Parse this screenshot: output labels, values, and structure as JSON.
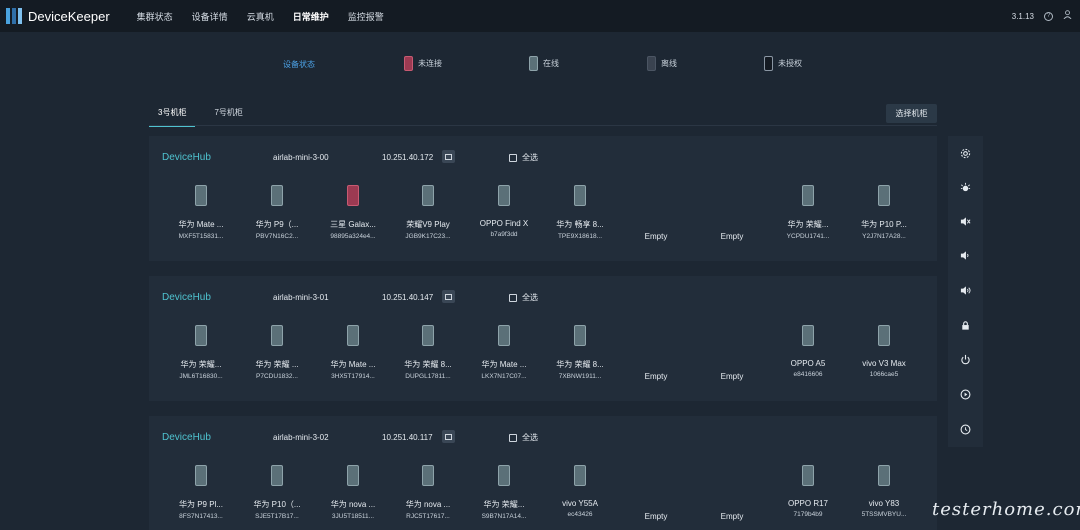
{
  "app": {
    "title": "DeviceKeeper",
    "version": "3.1.13"
  },
  "nav": {
    "items": [
      "集群状态",
      "设备详情",
      "云真机",
      "日常维护",
      "监控报警"
    ],
    "active_index": 3
  },
  "legend": {
    "title": "设备状态",
    "items": [
      {
        "label": "未连接",
        "color": "#9c3a52"
      },
      {
        "label": "在线",
        "color": "#5b7078"
      },
      {
        "label": "离线",
        "color": "#3a4350"
      },
      {
        "label": "未授权",
        "color": "#1a2028"
      }
    ]
  },
  "tabs": {
    "items": [
      "3号机柜",
      "7号机柜"
    ],
    "active_index": 0
  },
  "select_cabinet_label": "选择机柜",
  "select_all_label": "全选",
  "empty_label": "Empty",
  "cabinets": [
    {
      "hub": "DeviceHub",
      "id": "airlab-mini-3-00",
      "ip": "10.251.40.172",
      "slots": [
        {
          "name": "华为 Mate ...",
          "serial": "MXF5T15831...",
          "status": "online"
        },
        {
          "name": "华为 P9（...",
          "serial": "PBV7N16C2...",
          "status": "online"
        },
        {
          "name": "三星 Galax...",
          "serial": "98895a324e4...",
          "status": "unconnected"
        },
        {
          "name": "荣耀V9 Play",
          "serial": "JGB9K17C23...",
          "status": "online"
        },
        {
          "name": "OPPO Find X",
          "serial": "b7a9f3dd",
          "status": "online"
        },
        {
          "name": "华为 畅享 8...",
          "serial": "TPE9X18618...",
          "status": "online"
        },
        {
          "empty": true
        },
        {
          "empty": true
        },
        {
          "name": "华为 荣耀...",
          "serial": "YCPDU1741...",
          "status": "online"
        },
        {
          "name": "华为 P10 P...",
          "serial": "Y2J7N17A28...",
          "status": "online"
        }
      ]
    },
    {
      "hub": "DeviceHub",
      "id": "airlab-mini-3-01",
      "ip": "10.251.40.147",
      "slots": [
        {
          "name": "华为 荣耀...",
          "serial": "JML6T16830...",
          "status": "online"
        },
        {
          "name": "华为 荣耀 ...",
          "serial": "P7CDU1832...",
          "status": "online"
        },
        {
          "name": "华为 Mate ...",
          "serial": "3HX5T17914...",
          "status": "online"
        },
        {
          "name": "华为 荣耀 8...",
          "serial": "DUPGL17811...",
          "status": "online"
        },
        {
          "name": "华为 Mate ...",
          "serial": "LKX7N17C07...",
          "status": "online"
        },
        {
          "name": "华为 荣耀 8...",
          "serial": "7XBNW1911...",
          "status": "online"
        },
        {
          "empty": true
        },
        {
          "empty": true
        },
        {
          "name": "OPPO A5",
          "serial": "e8416606",
          "status": "online"
        },
        {
          "name": "vivo V3 Max",
          "serial": "1066cae5",
          "status": "online"
        }
      ]
    },
    {
      "hub": "DeviceHub",
      "id": "airlab-mini-3-02",
      "ip": "10.251.40.117",
      "slots": [
        {
          "name": "华为 P9 Pl...",
          "serial": "8FS7N17413...",
          "status": "online"
        },
        {
          "name": "华为 P10（...",
          "serial": "SJE5T17B17...",
          "status": "online"
        },
        {
          "name": "华为 nova ...",
          "serial": "3JU5T18511...",
          "status": "online"
        },
        {
          "name": "华为 nova ...",
          "serial": "RJC5T17617...",
          "status": "online"
        },
        {
          "name": "华为 荣耀...",
          "serial": "S9B7N17A14...",
          "status": "online"
        },
        {
          "name": "vivo Y55A",
          "serial": "ec43426",
          "status": "online"
        },
        {
          "empty": true
        },
        {
          "empty": true
        },
        {
          "name": "OPPO R17",
          "serial": "7179b4b9",
          "status": "online"
        },
        {
          "name": "vivo Y83",
          "serial": "5TSSMVBYU...",
          "status": "online"
        }
      ]
    }
  ],
  "toolbar": [
    "settings-icon",
    "brightness-icon",
    "mute-icon",
    "volume-down-icon",
    "volume-up-icon",
    "lock-icon",
    "power-icon",
    "play-icon",
    "clock-icon"
  ],
  "watermark": "testerhome.com"
}
